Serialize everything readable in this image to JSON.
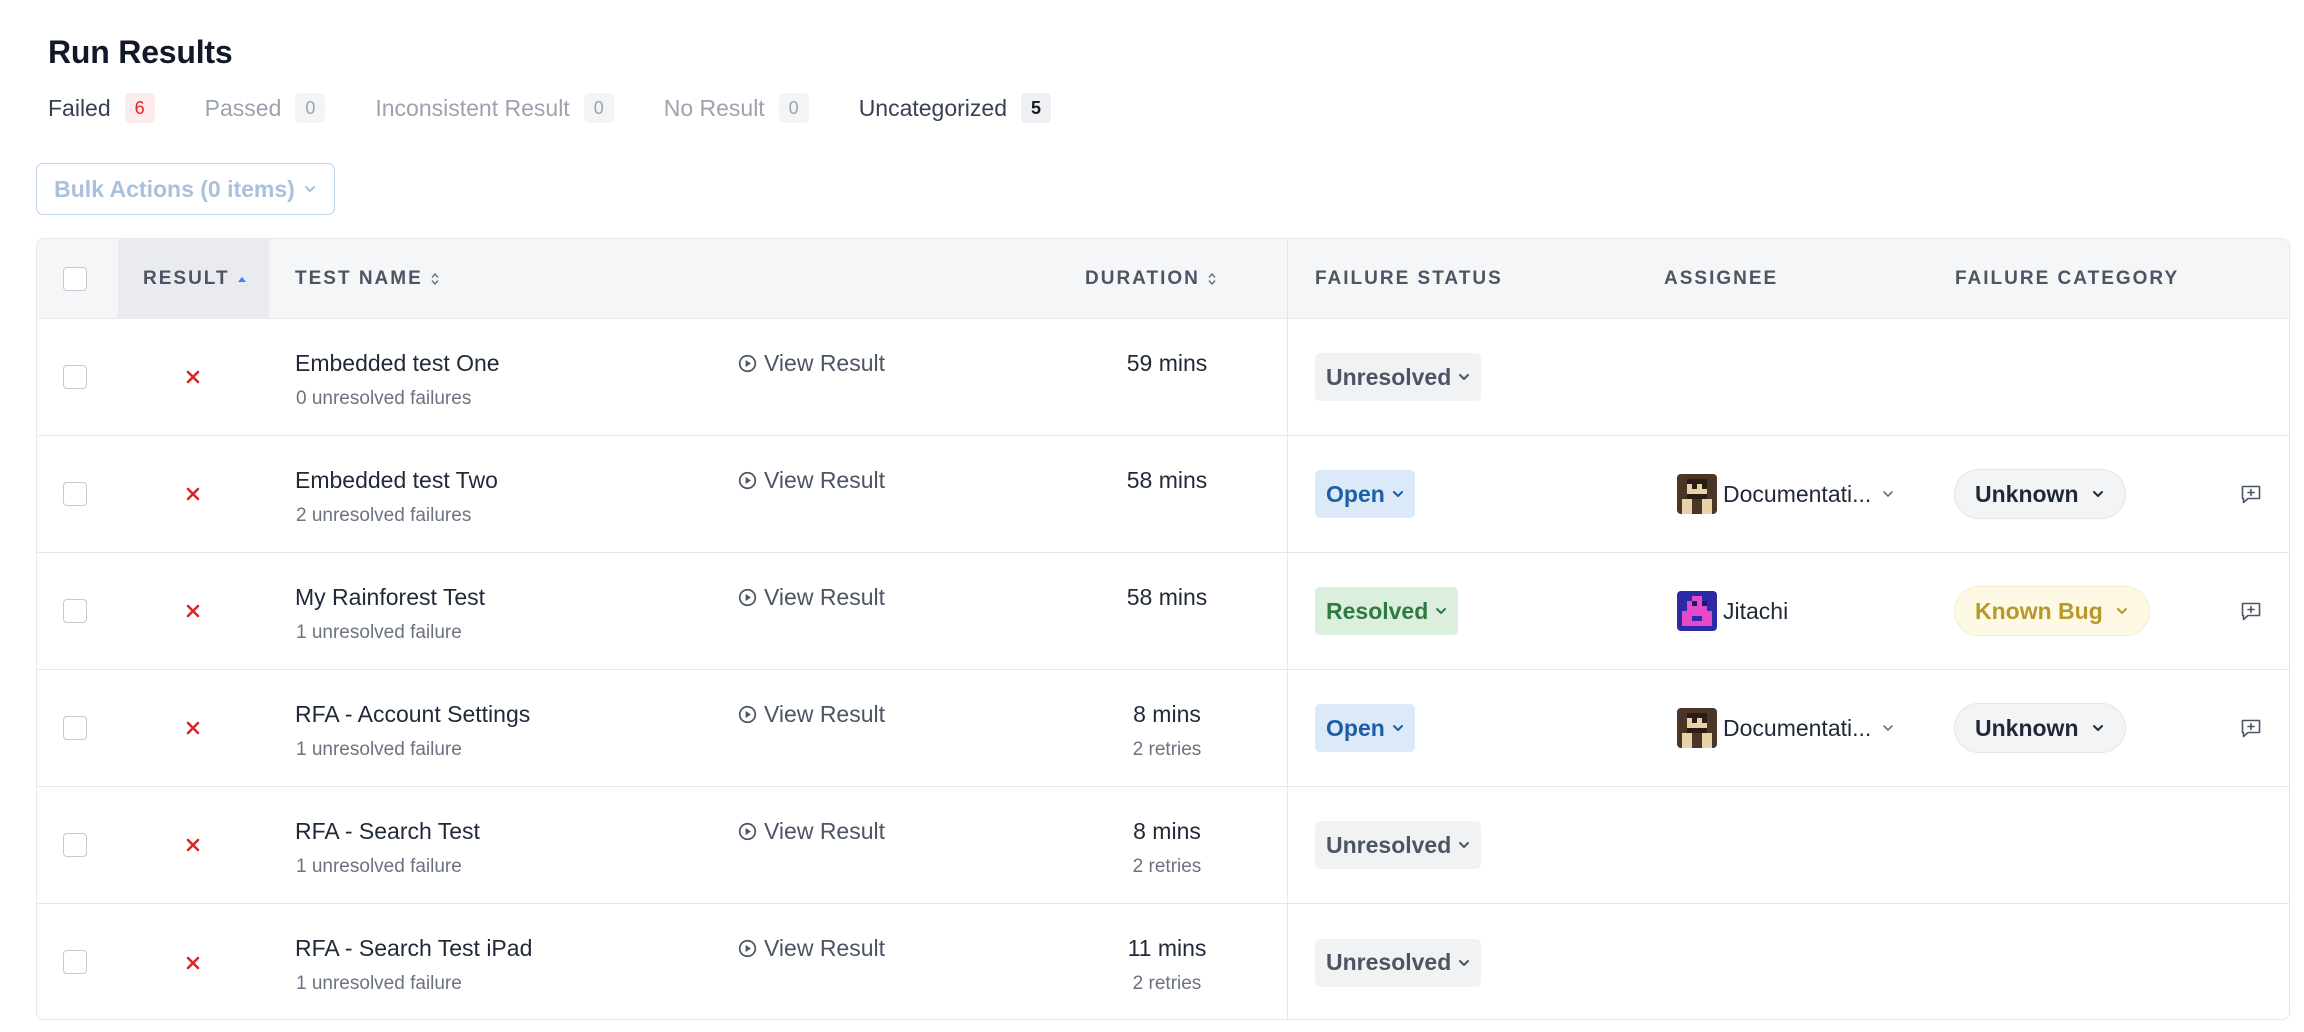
{
  "page_title": "Run Results",
  "tabs": [
    {
      "label": "Failed",
      "count": "6"
    },
    {
      "label": "Passed",
      "count": "0"
    },
    {
      "label": "Inconsistent Result",
      "count": "0"
    },
    {
      "label": "No Result",
      "count": "0"
    },
    {
      "label": "Uncategorized",
      "count": "5"
    }
  ],
  "bulk_actions_label": "Bulk Actions (0 items)",
  "table": {
    "headers": {
      "result": "RESULT",
      "test_name": "TEST NAME",
      "duration": "DURATION",
      "failure_status": "FAILURE STATUS",
      "assignee": "ASSIGNEE",
      "failure_category": "FAILURE CATEGORY"
    },
    "view_result_label": "View Result",
    "rows": [
      {
        "name": "Embedded test One",
        "failures": "0 unresolved failures",
        "duration": "59 mins",
        "retries": "",
        "status": "Unresolved",
        "assignee": "",
        "category": ""
      },
      {
        "name": "Embedded test Two",
        "failures": "2 unresolved failures",
        "duration": "58 mins",
        "retries": "",
        "status": "Open",
        "assignee": "Documentati...",
        "category": "Unknown"
      },
      {
        "name": "My Rainforest Test",
        "failures": "1 unresolved failure",
        "duration": "58 mins",
        "retries": "",
        "status": "Resolved",
        "assignee": "Jitachi",
        "category": "Known Bug"
      },
      {
        "name": "RFA - Account Settings",
        "failures": "1 unresolved failure",
        "duration": "8 mins",
        "retries": "2 retries",
        "status": "Open",
        "assignee": "Documentati...",
        "category": "Unknown"
      },
      {
        "name": "RFA - Search Test",
        "failures": "1 unresolved failure",
        "duration": "8 mins",
        "retries": "2 retries",
        "status": "Unresolved",
        "assignee": "",
        "category": ""
      },
      {
        "name": "RFA - Search Test iPad",
        "failures": "1 unresolved failure",
        "duration": "11 mins",
        "retries": "2 retries",
        "status": "Unresolved",
        "assignee": "",
        "category": ""
      }
    ]
  },
  "colors": {
    "fail_red": "#dc2626",
    "status_unresolved_bg": "#f1f2f4",
    "status_open_bg": "#dbe9f8",
    "status_resolved_bg": "#dcefdf",
    "category_unknown_bg": "#f3f4f6",
    "category_known_bug_bg": "#fdf9e5"
  },
  "icons": {
    "result_failed": "x-icon",
    "view_result": "play-circle-icon",
    "comment": "comment-add-icon",
    "dropdown": "chevron-down-icon",
    "sort": "sort-icon"
  }
}
